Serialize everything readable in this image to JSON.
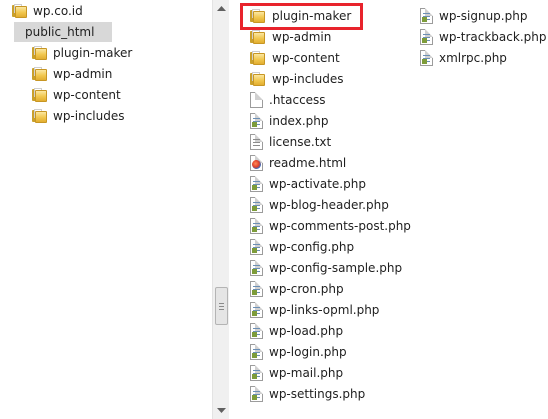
{
  "tree": {
    "items": [
      {
        "label": "wp.co.id",
        "level": 0
      },
      {
        "label": "public_html",
        "level": 1,
        "selected": true
      },
      {
        "label": "plugin-maker",
        "level": 2
      },
      {
        "label": "wp-admin",
        "level": 2
      },
      {
        "label": "wp-content",
        "level": 2
      },
      {
        "label": "wp-includes",
        "level": 2
      }
    ]
  },
  "files": {
    "column1": [
      {
        "label": "plugin-maker",
        "icon": "folder-icon",
        "highlighted": true
      },
      {
        "label": "wp-admin",
        "icon": "folder-icon"
      },
      {
        "label": "wp-content",
        "icon": "folder-icon"
      },
      {
        "label": "wp-includes",
        "icon": "folder-icon"
      },
      {
        "label": ".htaccess",
        "icon": "file-icon"
      },
      {
        "label": "index.php",
        "icon": "php-file-icon"
      },
      {
        "label": "license.txt",
        "icon": "text-file-icon"
      },
      {
        "label": "readme.html",
        "icon": "html-file-icon"
      },
      {
        "label": "wp-activate.php",
        "icon": "php-file-icon"
      },
      {
        "label": "wp-blog-header.php",
        "icon": "php-file-icon"
      },
      {
        "label": "wp-comments-post.php",
        "icon": "php-file-icon"
      },
      {
        "label": "wp-config.php",
        "icon": "php-file-icon"
      },
      {
        "label": "wp-config-sample.php",
        "icon": "php-file-icon"
      },
      {
        "label": "wp-cron.php",
        "icon": "php-file-icon"
      },
      {
        "label": "wp-links-opml.php",
        "icon": "php-file-icon"
      },
      {
        "label": "wp-load.php",
        "icon": "php-file-icon"
      },
      {
        "label": "wp-login.php",
        "icon": "php-file-icon"
      },
      {
        "label": "wp-mail.php",
        "icon": "php-file-icon"
      },
      {
        "label": "wp-settings.php",
        "icon": "php-file-icon"
      }
    ],
    "column2": [
      {
        "label": "wp-signup.php",
        "icon": "php-file-icon"
      },
      {
        "label": "wp-trackback.php",
        "icon": "php-file-icon"
      },
      {
        "label": "xmlrpc.php",
        "icon": "php-file-icon"
      }
    ]
  },
  "colors": {
    "highlight_border": "#e8232c",
    "selected_background": "#d8d8d8"
  }
}
